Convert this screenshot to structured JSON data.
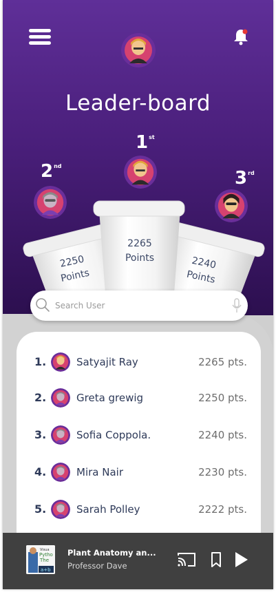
{
  "header": {
    "title": "Leader-board",
    "menu_icon": "hamburger-menu-icon",
    "bell_icon": "notification-bell-icon",
    "bell_badge_color": "#e53935"
  },
  "podium": {
    "first": {
      "rank": "1",
      "suffix": "st",
      "points": "2265",
      "unit": "Points"
    },
    "second": {
      "rank": "2",
      "suffix": "nd",
      "points": "2250",
      "unit": "Points"
    },
    "third": {
      "rank": "3",
      "suffix": "rd",
      "points": "2240",
      "unit": "Points"
    }
  },
  "search": {
    "placeholder": "Search User",
    "search_icon": "search-icon",
    "mic_icon": "microphone-icon"
  },
  "leaderboard": [
    {
      "rank": "1.",
      "name": "Satyajit Ray",
      "points": "2265 pts."
    },
    {
      "rank": "2.",
      "name": "Greta grewig",
      "points": "2250 pts."
    },
    {
      "rank": "3.",
      "name": "Sofia Coppola.",
      "points": "2240 pts."
    },
    {
      "rank": "4.",
      "name": "Mira Nair",
      "points": "2230 pts."
    },
    {
      "rank": "5.",
      "name": "Sarah Polley",
      "points": "2222 pts."
    }
  ],
  "player": {
    "title": "Plant Anatomy an...",
    "subtitle": "Professor Dave",
    "thumb_text": [
      "Visua",
      "Pytho",
      "The",
      "a+b"
    ]
  },
  "colors": {
    "accent_purple": "#5f2f98",
    "text_dark": "#2e3a59",
    "player_bg": "#404040"
  }
}
